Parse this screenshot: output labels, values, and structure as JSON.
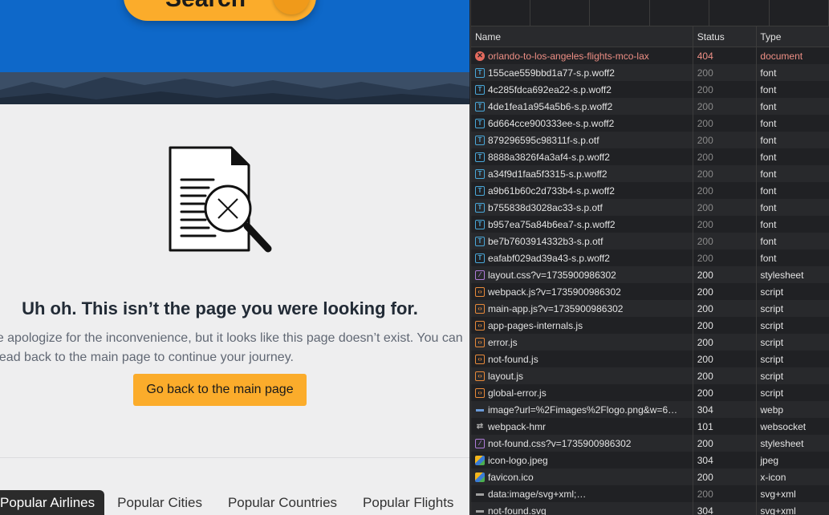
{
  "page": {
    "search_button_label": "Search",
    "error_title": "Uh oh. This isn’t the page you were looking for.",
    "error_message_line1": "We apologize for the inconvenience, but it looks like this page doesn’t exist. You can",
    "error_message_line2": "head back to the main page to continue your journey.",
    "home_button_label": "Go back to the main page",
    "tabs": [
      {
        "label": "Popular Airlines",
        "active": true
      },
      {
        "label": "Popular Cities",
        "active": false
      },
      {
        "label": "Popular Countries",
        "active": false
      },
      {
        "label": "Popular Flights",
        "active": false
      }
    ],
    "colors": {
      "hero": "#0e68c9",
      "accent": "#fbac2b",
      "background": "#eeeeef"
    }
  },
  "network": {
    "columns": {
      "name": "Name",
      "status": "Status",
      "type": "Type"
    },
    "requests": [
      {
        "name": "orlando-to-los-angeles-flights-mco-lax",
        "status": "404",
        "type": "document",
        "icon": "error-icon",
        "error": true
      },
      {
        "name": "155cae559bbd1a77-s.p.woff2",
        "status": "200",
        "type": "font",
        "icon": "font-icon",
        "muted": true
      },
      {
        "name": "4c285fdca692ea22-s.p.woff2",
        "status": "200",
        "type": "font",
        "icon": "font-icon",
        "muted": true
      },
      {
        "name": "4de1fea1a954a5b6-s.p.woff2",
        "status": "200",
        "type": "font",
        "icon": "font-icon",
        "muted": true
      },
      {
        "name": "6d664cce900333ee-s.p.woff2",
        "status": "200",
        "type": "font",
        "icon": "font-icon",
        "muted": true
      },
      {
        "name": "879296595c98311f-s.p.otf",
        "status": "200",
        "type": "font",
        "icon": "font-icon",
        "muted": true
      },
      {
        "name": "8888a3826f4a3af4-s.p.woff2",
        "status": "200",
        "type": "font",
        "icon": "font-icon",
        "muted": true
      },
      {
        "name": "a34f9d1faa5f3315-s.p.woff2",
        "status": "200",
        "type": "font",
        "icon": "font-icon",
        "muted": true
      },
      {
        "name": "a9b61b60c2d733b4-s.p.woff2",
        "status": "200",
        "type": "font",
        "icon": "font-icon",
        "muted": true
      },
      {
        "name": "b755838d3028ac33-s.p.otf",
        "status": "200",
        "type": "font",
        "icon": "font-icon",
        "muted": true
      },
      {
        "name": "b957ea75a84b6ea7-s.p.woff2",
        "status": "200",
        "type": "font",
        "icon": "font-icon",
        "muted": true
      },
      {
        "name": "be7b7603914332b3-s.p.otf",
        "status": "200",
        "type": "font",
        "icon": "font-icon",
        "muted": true
      },
      {
        "name": "eafabf029ad39a43-s.p.woff2",
        "status": "200",
        "type": "font",
        "icon": "font-icon",
        "muted": true
      },
      {
        "name": "layout.css?v=1735900986302",
        "status": "200",
        "type": "stylesheet",
        "icon": "stylesheet-icon"
      },
      {
        "name": "webpack.js?v=1735900986302",
        "status": "200",
        "type": "script",
        "icon": "script-icon"
      },
      {
        "name": "main-app.js?v=1735900986302",
        "status": "200",
        "type": "script",
        "icon": "script-icon"
      },
      {
        "name": "app-pages-internals.js",
        "status": "200",
        "type": "script",
        "icon": "script-icon"
      },
      {
        "name": "error.js",
        "status": "200",
        "type": "script",
        "icon": "script-icon"
      },
      {
        "name": "not-found.js",
        "status": "200",
        "type": "script",
        "icon": "script-icon"
      },
      {
        "name": "layout.js",
        "status": "200",
        "type": "script",
        "icon": "script-icon"
      },
      {
        "name": "global-error.js",
        "status": "200",
        "type": "script",
        "icon": "script-icon"
      },
      {
        "name": "image?url=%2Fimages%2Flogo.png&w=6…",
        "status": "304",
        "type": "webp",
        "icon": "webp-icon"
      },
      {
        "name": "webpack-hmr",
        "status": "101",
        "type": "websocket",
        "icon": "websocket-icon"
      },
      {
        "name": "not-found.css?v=1735900986302",
        "status": "200",
        "type": "stylesheet",
        "icon": "stylesheet-icon"
      },
      {
        "name": "icon-logo.jpeg",
        "status": "304",
        "type": "jpeg",
        "icon": "image-icon"
      },
      {
        "name": "favicon.ico",
        "status": "200",
        "type": "x-icon",
        "icon": "image-icon"
      },
      {
        "name": "data:image/svg+xml;…",
        "status": "200",
        "type": "svg+xml",
        "icon": "svg-icon",
        "muted": true
      },
      {
        "name": "not-found.svg",
        "status": "304",
        "type": "svg+xml",
        "icon": "svg-icon"
      }
    ]
  }
}
